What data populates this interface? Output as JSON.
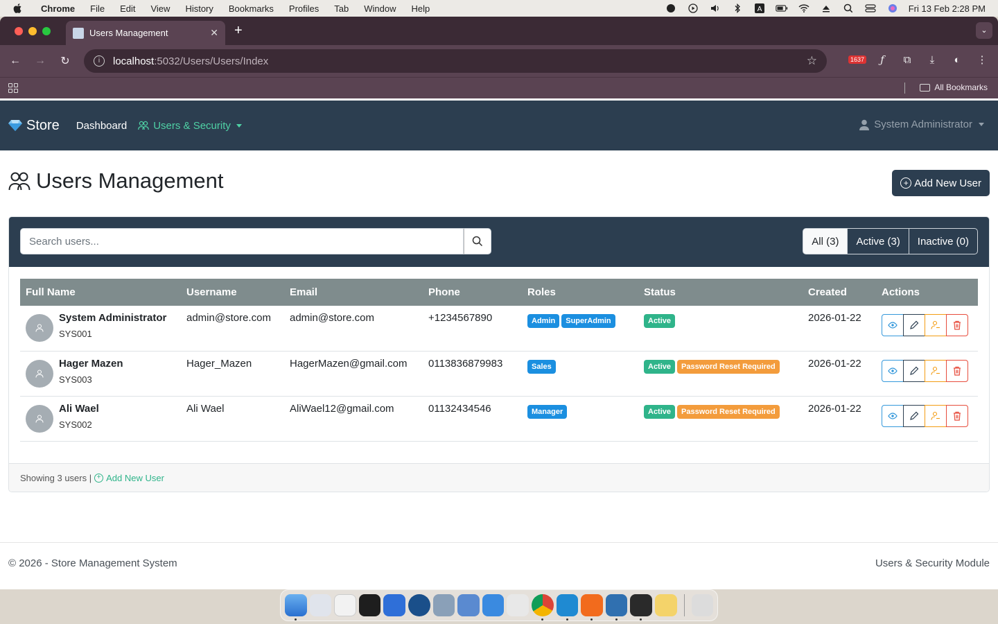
{
  "menubar": {
    "items": [
      "Chrome",
      "File",
      "Edit",
      "View",
      "History",
      "Bookmarks",
      "Profiles",
      "Tab",
      "Window",
      "Help"
    ],
    "clock": "Fri 13 Feb  2:28 PM"
  },
  "browser": {
    "tab_title": "Users Management",
    "url_host": "localhost",
    "url_path": ":5032/Users/Users/Index",
    "extension_badge": "1637",
    "all_bookmarks": "All Bookmarks"
  },
  "navbar": {
    "brand": "Store",
    "links": {
      "dashboard": "Dashboard",
      "users_security": "Users & Security"
    },
    "user": "System Administrator"
  },
  "header": {
    "title": "Users Management",
    "add_button": "Add New User"
  },
  "filters": {
    "search_placeholder": "Search users...",
    "all": "All (3)",
    "active": "Active (3)",
    "inactive": "Inactive (0)"
  },
  "table": {
    "columns": [
      "Full Name",
      "Username",
      "Email",
      "Phone",
      "Roles",
      "Status",
      "Created",
      "Actions"
    ],
    "rows": [
      {
        "full_name": "System Administrator",
        "code": "SYS001",
        "username": "admin@store.com",
        "email": "admin@store.com",
        "phone": "+1234567890",
        "roles": [
          "Admin",
          "SuperAdmin"
        ],
        "status": "Active",
        "status_extra": "",
        "created": "2026-01-22"
      },
      {
        "full_name": "Hager Mazen",
        "code": "SYS003",
        "username": "Hager_Mazen",
        "email": "HagerMazen@gmail.com",
        "phone": "0113836879983",
        "roles": [
          "Sales"
        ],
        "status": "Active",
        "status_extra": "Password Reset Required",
        "created": "2026-01-22"
      },
      {
        "full_name": "Ali Wael",
        "code": "SYS002",
        "username": "Ali Wael",
        "email": "AliWael12@gmail.com",
        "phone": "01132434546",
        "roles": [
          "Manager"
        ],
        "status": "Active",
        "status_extra": "Password Reset Required",
        "created": "2026-01-22"
      }
    ]
  },
  "card_footer": {
    "showing": "Showing 3 users |",
    "add_link": "Add New User"
  },
  "site_footer": {
    "left": "© 2026 - Store Management System",
    "right": "Users & Security Module"
  },
  "colors": {
    "navbar": "#2c3e50",
    "accent": "#2fb48a",
    "table_header": "#7f8c8d",
    "role_badge": "#1b8fe0",
    "warning_badge": "#f39c3c"
  },
  "icons": {
    "row_actions": [
      "eye-icon",
      "pencil-icon",
      "user-role-icon",
      "trash-icon"
    ]
  }
}
